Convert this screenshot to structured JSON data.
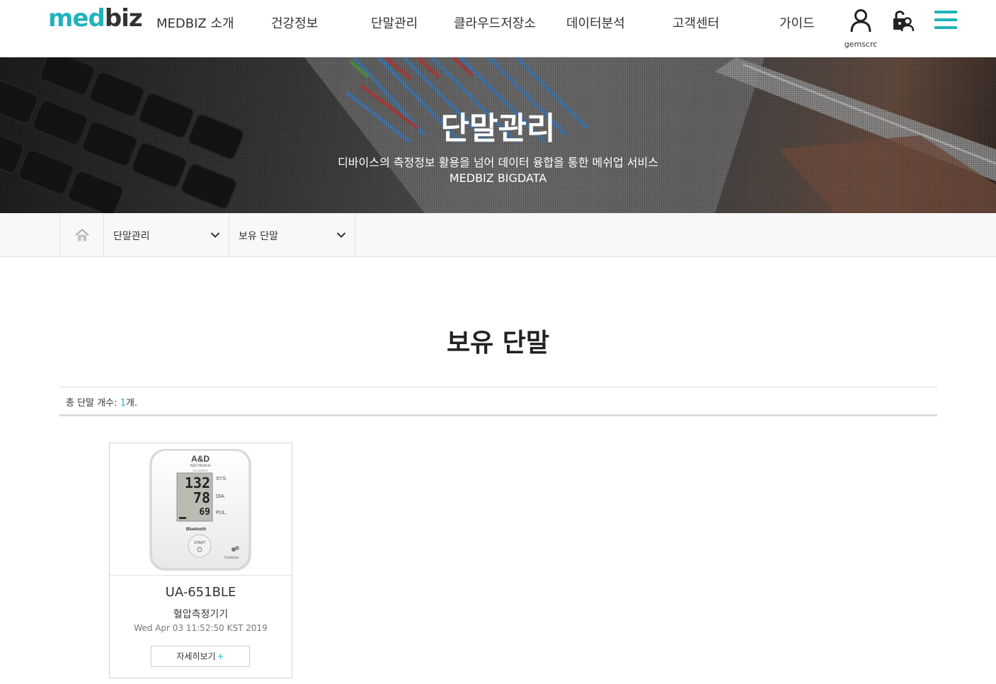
{
  "header": {
    "logo_part1": "med",
    "logo_part2": "biz",
    "nav": [
      "MEDBIZ 소개",
      "건강정보",
      "단말관리",
      "클라우드저장소",
      "데이터분석",
      "고객센터",
      "가이드"
    ],
    "user_name": "gemscrc",
    "icons": [
      "user-icon",
      "lock-icon",
      "menu-icon"
    ]
  },
  "banner": {
    "title": "단말관리",
    "subtitle": "디바이스의 측정정보 활용을 넘어 데이터 융합을 통한 메쉬업 서비스",
    "subtitle2": "MEDBIZ BIGDATA"
  },
  "breadcrumb": {
    "home_icon": "home-icon",
    "level1": "단말관리",
    "level2": "보유 단말"
  },
  "main": {
    "title": "보유 단말",
    "count_prefix": "총 단말 개수: ",
    "count_value": "1",
    "count_suffix": "개."
  },
  "devices": [
    {
      "brand": "A&D",
      "brand_sub": "A&D Medical",
      "model": "UA-651BLE",
      "type": "혈압측정기기",
      "date": "Wed Apr 03 11:52:50 KST 2019",
      "detail_label": "자세히보기",
      "detail_plus": "+",
      "screen_sys": "132",
      "screen_dia": "78",
      "screen_pul": "69",
      "label_sys": "SYS.",
      "label_dia": "DIA.",
      "label_pul": "PUL.",
      "bluetooth_label": "Bluetooth",
      "start_label": "START",
      "continua_label": "Continua"
    }
  ],
  "colors": {
    "accent": "#1fb3bd",
    "text": "#222222",
    "border": "#dcdcdc"
  }
}
